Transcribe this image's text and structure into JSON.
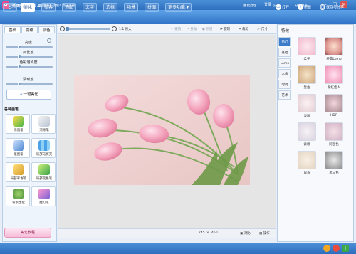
{
  "app": {
    "title": "美图秀秀 4.0.1",
    "login": "登录"
  },
  "window": {
    "minimize": "–",
    "maximize": "□",
    "close": "×"
  },
  "nav": {
    "home_icon": "⌂",
    "tabs": [
      "美化",
      "美容",
      "饰品",
      "文字",
      "边框",
      "场景",
      "拼图",
      "更多功能 ▾"
    ],
    "open": "打开",
    "new": "新建",
    "save_share": "保存与分享"
  },
  "left": {
    "subtabs": [
      "基础",
      "高级",
      "调色"
    ],
    "sliders": [
      {
        "label": "亮度",
        "value": 0.3
      },
      {
        "label": "对比度",
        "value": 0.3
      },
      {
        "label": "色彩饱和度",
        "value": 0.3
      },
      {
        "label": "清晰度",
        "value": 0.3
      }
    ],
    "onekey": "一键美化",
    "brush_title": "各种画笔",
    "tools": [
      {
        "label": "涂鸦笔"
      },
      {
        "label": "消除笔"
      },
      {
        "label": "抠图笔"
      },
      {
        "label": "局部马赛克"
      },
      {
        "label": "局部彩色笔"
      },
      {
        "label": "局部变色笔"
      },
      {
        "label": "背景虚化"
      },
      {
        "label": "魔幻笔"
      }
    ],
    "pro": "美化教程"
  },
  "toolbar": {
    "zoom_label": "1:1 原大",
    "undo": "撤销",
    "redo": "重做",
    "reset": "原图",
    "rotate": "旋转",
    "crop": "裁剪",
    "size": "尺寸"
  },
  "status": {
    "width": "745",
    "x": "×",
    "height": "450",
    "compare": "对比",
    "ops": "操作"
  },
  "right": {
    "title": "特效：",
    "filter_tabs": [
      "热门",
      "基础",
      "Lomo",
      "人像",
      "时尚",
      "艺术"
    ],
    "effects": [
      "柔光",
      "经典Lomo",
      "复古",
      "粉红佳人",
      "淡雅",
      "HDR",
      "云端",
      "阿宝色",
      "日系",
      "黑白色"
    ]
  },
  "bottom": {
    "tip": "怎么使用美图秀秀的【抠图笔】功能？点击查看",
    "batch": "批处理",
    "share": "分享",
    "friends": "分享更多"
  },
  "colors": {
    "accent": "#2f74c7",
    "nav_bg": "#4a8fd6"
  }
}
